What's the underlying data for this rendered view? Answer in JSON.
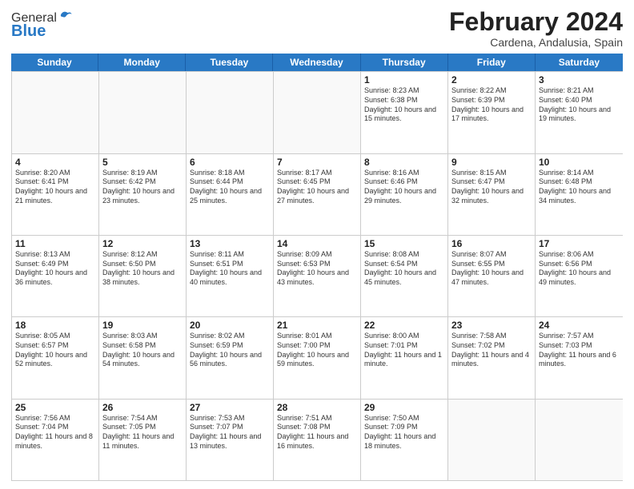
{
  "logo": {
    "general": "General",
    "blue": "Blue"
  },
  "header": {
    "month": "February 2024",
    "location": "Cardena, Andalusia, Spain"
  },
  "weekdays": [
    "Sunday",
    "Monday",
    "Tuesday",
    "Wednesday",
    "Thursday",
    "Friday",
    "Saturday"
  ],
  "rows": [
    [
      {
        "day": "",
        "info": ""
      },
      {
        "day": "",
        "info": ""
      },
      {
        "day": "",
        "info": ""
      },
      {
        "day": "",
        "info": ""
      },
      {
        "day": "1",
        "info": "Sunrise: 8:23 AM\nSunset: 6:38 PM\nDaylight: 10 hours and 15 minutes."
      },
      {
        "day": "2",
        "info": "Sunrise: 8:22 AM\nSunset: 6:39 PM\nDaylight: 10 hours and 17 minutes."
      },
      {
        "day": "3",
        "info": "Sunrise: 8:21 AM\nSunset: 6:40 PM\nDaylight: 10 hours and 19 minutes."
      }
    ],
    [
      {
        "day": "4",
        "info": "Sunrise: 8:20 AM\nSunset: 6:41 PM\nDaylight: 10 hours and 21 minutes."
      },
      {
        "day": "5",
        "info": "Sunrise: 8:19 AM\nSunset: 6:42 PM\nDaylight: 10 hours and 23 minutes."
      },
      {
        "day": "6",
        "info": "Sunrise: 8:18 AM\nSunset: 6:44 PM\nDaylight: 10 hours and 25 minutes."
      },
      {
        "day": "7",
        "info": "Sunrise: 8:17 AM\nSunset: 6:45 PM\nDaylight: 10 hours and 27 minutes."
      },
      {
        "day": "8",
        "info": "Sunrise: 8:16 AM\nSunset: 6:46 PM\nDaylight: 10 hours and 29 minutes."
      },
      {
        "day": "9",
        "info": "Sunrise: 8:15 AM\nSunset: 6:47 PM\nDaylight: 10 hours and 32 minutes."
      },
      {
        "day": "10",
        "info": "Sunrise: 8:14 AM\nSunset: 6:48 PM\nDaylight: 10 hours and 34 minutes."
      }
    ],
    [
      {
        "day": "11",
        "info": "Sunrise: 8:13 AM\nSunset: 6:49 PM\nDaylight: 10 hours and 36 minutes."
      },
      {
        "day": "12",
        "info": "Sunrise: 8:12 AM\nSunset: 6:50 PM\nDaylight: 10 hours and 38 minutes."
      },
      {
        "day": "13",
        "info": "Sunrise: 8:11 AM\nSunset: 6:51 PM\nDaylight: 10 hours and 40 minutes."
      },
      {
        "day": "14",
        "info": "Sunrise: 8:09 AM\nSunset: 6:53 PM\nDaylight: 10 hours and 43 minutes."
      },
      {
        "day": "15",
        "info": "Sunrise: 8:08 AM\nSunset: 6:54 PM\nDaylight: 10 hours and 45 minutes."
      },
      {
        "day": "16",
        "info": "Sunrise: 8:07 AM\nSunset: 6:55 PM\nDaylight: 10 hours and 47 minutes."
      },
      {
        "day": "17",
        "info": "Sunrise: 8:06 AM\nSunset: 6:56 PM\nDaylight: 10 hours and 49 minutes."
      }
    ],
    [
      {
        "day": "18",
        "info": "Sunrise: 8:05 AM\nSunset: 6:57 PM\nDaylight: 10 hours and 52 minutes."
      },
      {
        "day": "19",
        "info": "Sunrise: 8:03 AM\nSunset: 6:58 PM\nDaylight: 10 hours and 54 minutes."
      },
      {
        "day": "20",
        "info": "Sunrise: 8:02 AM\nSunset: 6:59 PM\nDaylight: 10 hours and 56 minutes."
      },
      {
        "day": "21",
        "info": "Sunrise: 8:01 AM\nSunset: 7:00 PM\nDaylight: 10 hours and 59 minutes."
      },
      {
        "day": "22",
        "info": "Sunrise: 8:00 AM\nSunset: 7:01 PM\nDaylight: 11 hours and 1 minute."
      },
      {
        "day": "23",
        "info": "Sunrise: 7:58 AM\nSunset: 7:02 PM\nDaylight: 11 hours and 4 minutes."
      },
      {
        "day": "24",
        "info": "Sunrise: 7:57 AM\nSunset: 7:03 PM\nDaylight: 11 hours and 6 minutes."
      }
    ],
    [
      {
        "day": "25",
        "info": "Sunrise: 7:56 AM\nSunset: 7:04 PM\nDaylight: 11 hours and 8 minutes."
      },
      {
        "day": "26",
        "info": "Sunrise: 7:54 AM\nSunset: 7:05 PM\nDaylight: 11 hours and 11 minutes."
      },
      {
        "day": "27",
        "info": "Sunrise: 7:53 AM\nSunset: 7:07 PM\nDaylight: 11 hours and 13 minutes."
      },
      {
        "day": "28",
        "info": "Sunrise: 7:51 AM\nSunset: 7:08 PM\nDaylight: 11 hours and 16 minutes."
      },
      {
        "day": "29",
        "info": "Sunrise: 7:50 AM\nSunset: 7:09 PM\nDaylight: 11 hours and 18 minutes."
      },
      {
        "day": "",
        "info": ""
      },
      {
        "day": "",
        "info": ""
      }
    ]
  ]
}
